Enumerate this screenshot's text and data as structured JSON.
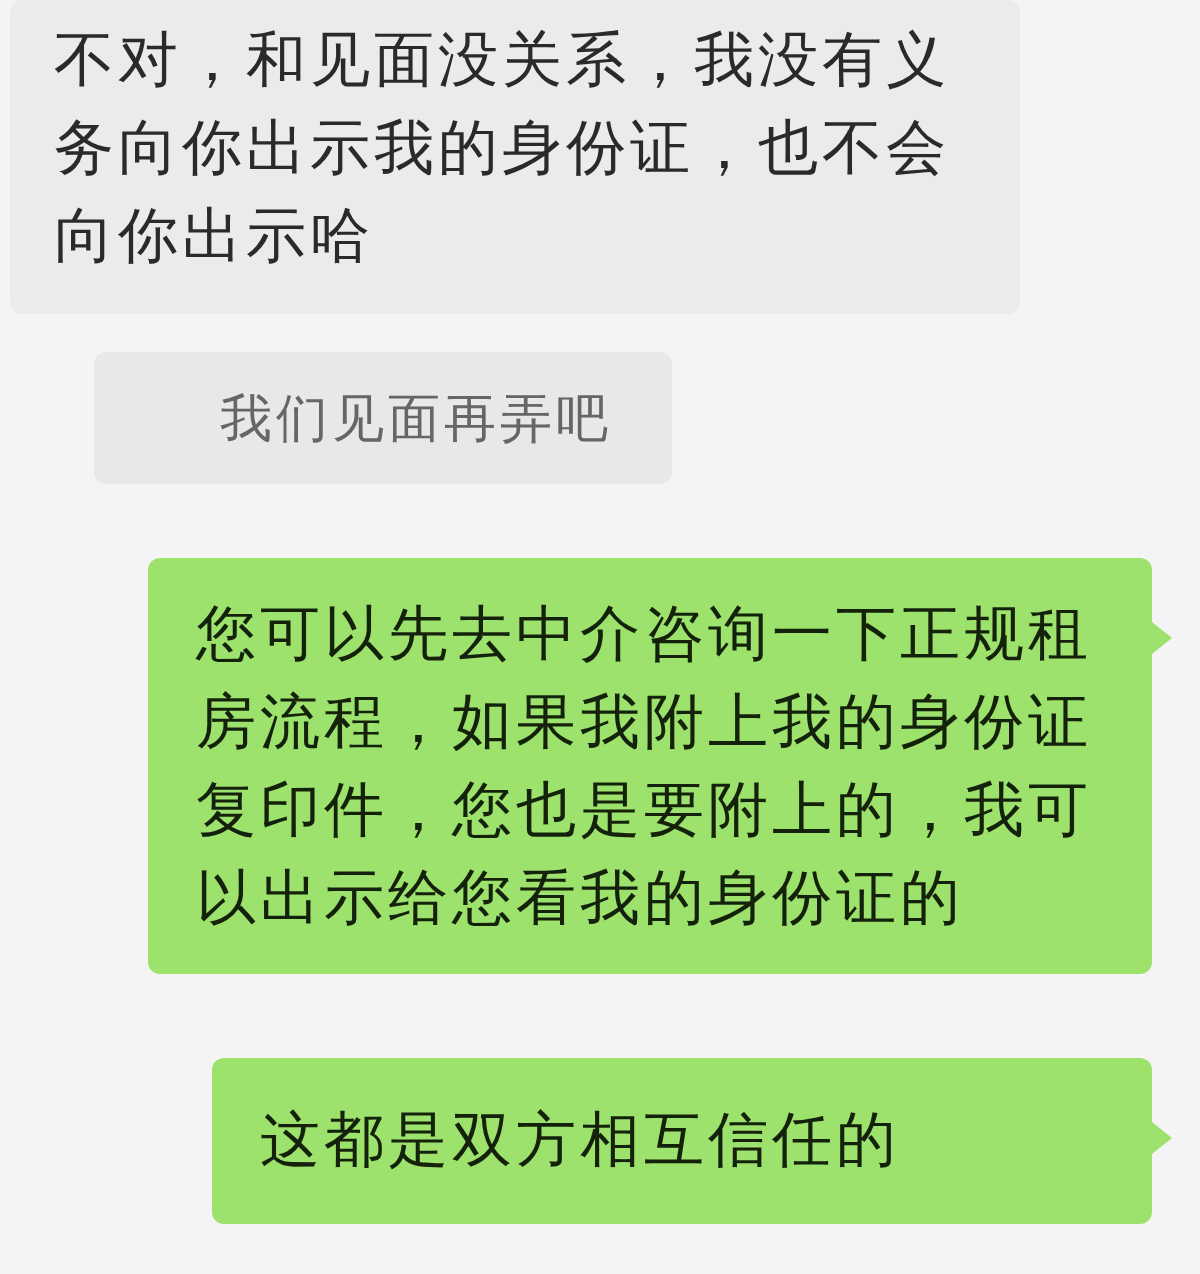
{
  "messages": [
    {
      "kind": "received",
      "text": "不对，和见面没关系，我没有义务向你出示我的身份证，也不会向你出示哈"
    },
    {
      "kind": "received_muted",
      "text": "我们见面再弄吧"
    },
    {
      "kind": "sent",
      "text": "您可以先去中介咨询一下正规租房流程，如果我附上我的身份证复印件，您也是要附上的，我可以出示给您看我的身份证的"
    },
    {
      "kind": "sent",
      "text": "这都是双方相互信任的"
    }
  ]
}
